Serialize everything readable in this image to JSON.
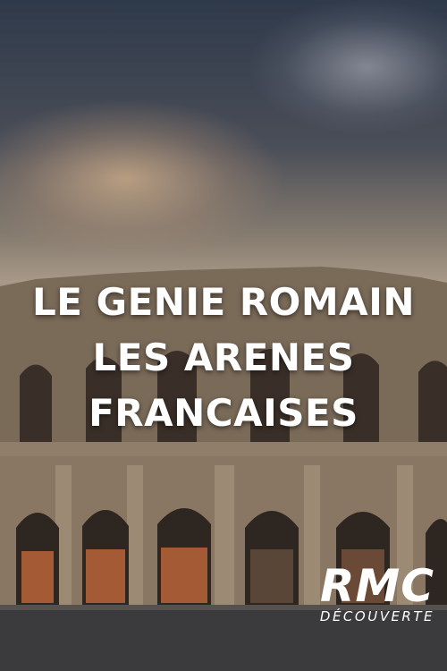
{
  "poster": {
    "title_lines": [
      "LE GENIE ROMAIN",
      "LES ARENES",
      "FRANCAISES"
    ],
    "logo_main": "RMC",
    "logo_sub": "DÉCOUVERTE"
  },
  "colors": {
    "sky_top": "#2f3a4a",
    "sky_glow": "#d6b28c",
    "stone": "#8a7763",
    "doors": "#a35a35",
    "ground": "#3b3a3c",
    "text": "#ffffff"
  }
}
